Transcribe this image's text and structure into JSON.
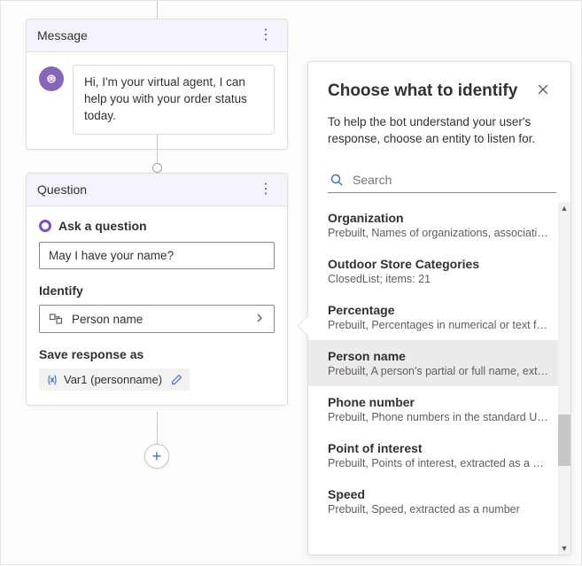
{
  "canvas": {
    "message_card": {
      "title": "Message",
      "bot_text": "Hi, I'm your virtual agent, I can help you with your order status today."
    },
    "question_card": {
      "title": "Question",
      "ask_label": "Ask a question",
      "question_value": "May I have your name?",
      "identify_label": "Identify",
      "identify_value": "Person name",
      "save_as_label": "Save response as",
      "variable_name": "Var1",
      "variable_type": "personname"
    }
  },
  "panel": {
    "title": "Choose what to identify",
    "description": "To help the bot understand your user's response, choose an entity to listen for.",
    "search_placeholder": "Search",
    "items": [
      {
        "name": "Organization",
        "meta": "Prebuilt, Names of organizations, associations.",
        "selected": false
      },
      {
        "name": "Outdoor Store Categories",
        "meta": "ClosedList; items: 21",
        "selected": false
      },
      {
        "name": "Percentage",
        "meta": "Prebuilt, Percentages in numerical or text for...",
        "selected": false
      },
      {
        "name": "Person name",
        "meta": "Prebuilt, A person's partial or full name, extra..",
        "selected": true
      },
      {
        "name": "Phone number",
        "meta": "Prebuilt, Phone numbers in the standard US f..",
        "selected": false
      },
      {
        "name": "Point of interest",
        "meta": "Prebuilt, Points of interest, extracted as a string",
        "selected": false
      },
      {
        "name": "Speed",
        "meta": "Prebuilt, Speed, extracted as a number",
        "selected": false
      }
    ]
  }
}
